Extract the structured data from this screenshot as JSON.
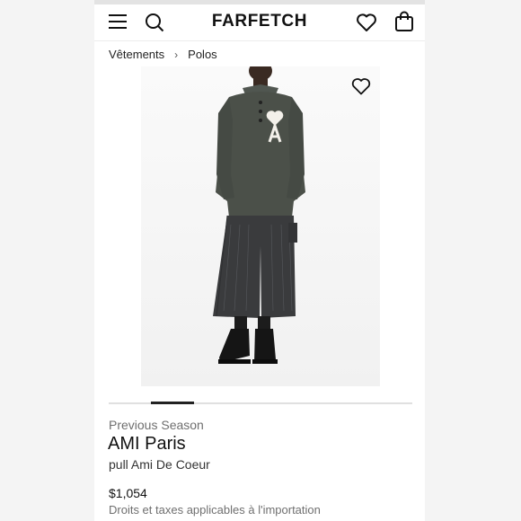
{
  "header": {
    "logo": "FARFETCH",
    "icons": [
      "menu-icon",
      "search-icon",
      "heart-icon",
      "shopping-bag-icon"
    ]
  },
  "breadcrumb": {
    "items": [
      "Vêtements",
      "Polos"
    ],
    "separator": "›"
  },
  "gallery": {
    "wishlist_icon": "heart-outline-icon",
    "current_progress": 0.28
  },
  "product": {
    "season": "Previous Season",
    "brand": "AMI Paris",
    "name": "pull Ami De Coeur",
    "price": "$1,054",
    "duties_note": "Droits et taxes applicables à l'importation"
  },
  "colors": {
    "accent": "#222222",
    "muted_text": "#6f6f6f",
    "sweater": "#4b5049",
    "trousers": "#3a3b3d"
  }
}
